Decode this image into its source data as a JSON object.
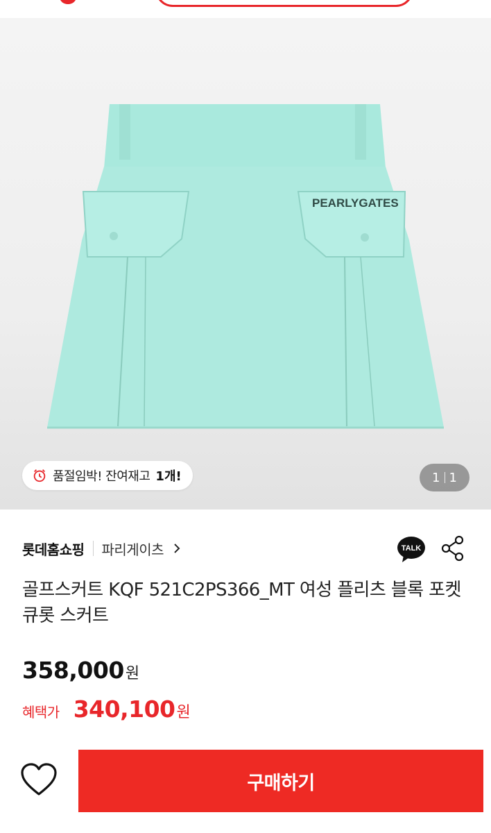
{
  "hero": {
    "brand_print": "PEARLYGATES",
    "stock_notice": "품절임박! 잔여재고",
    "stock_count": "1개!",
    "pager_current": "1",
    "pager_total": "1"
  },
  "store": {
    "name": "롯데홈쇼핑",
    "brand": "파리게이츠"
  },
  "actions": {
    "talk_label": "TALK"
  },
  "product": {
    "title": "골프스커트 KQF 521C2PS366_MT 여성 플리츠 블록 포켓 큐롯 스커트",
    "price": "358,000",
    "price_unit": "원",
    "benefit_label": "혜택가",
    "benefit_price": "340,100",
    "benefit_unit": "원"
  },
  "footer": {
    "buy_label": "구매하기"
  },
  "colors": {
    "accent": "#ee2a24",
    "skirt": "#a7e8dc"
  }
}
